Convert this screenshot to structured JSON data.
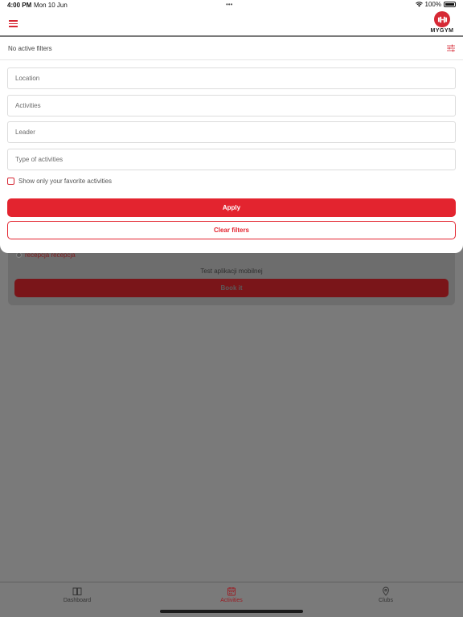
{
  "status_bar": {
    "time": "4:00 PM",
    "date": "Mon 10 Jun",
    "battery": "100%"
  },
  "header": {
    "logo_text": "MYGYM"
  },
  "filters": {
    "status": "No active filters",
    "location_placeholder": "Location",
    "activities_placeholder": "Activities",
    "leader_placeholder": "Leader",
    "type_placeholder": "Type of activities",
    "favorite_label": "Show only your favorite activities",
    "apply_label": "Apply",
    "clear_label": "Clear filters"
  },
  "activity_card": {
    "reception": "recepcja recepcja",
    "description": "Test aplikacji mobilnej",
    "book_label": "Book it"
  },
  "tabs": [
    {
      "label": "Dashboard",
      "icon": "book-icon",
      "active": false
    },
    {
      "label": "Activities",
      "icon": "calendar-icon",
      "active": true
    },
    {
      "label": "Clubs",
      "icon": "location-pin-icon",
      "active": false
    }
  ],
  "colors": {
    "accent": "#e3242f",
    "dim_overlay": "#7a7a7a"
  }
}
